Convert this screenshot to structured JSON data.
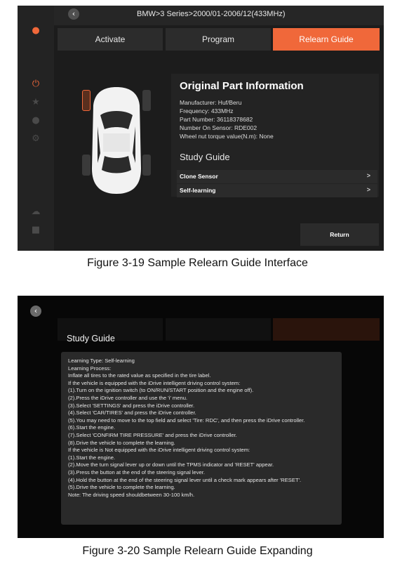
{
  "figure1": {
    "breadcrumb": "BMW>3 Series>2000/01-2006/12(433MHz)",
    "tabs": [
      "Activate",
      "Program",
      "Relearn Guide"
    ],
    "active_tab": "Relearn Guide",
    "sidebar_icons": [
      "user-icon",
      "tpms-icon",
      "star-icon",
      "lightbulb-icon",
      "gear-icon",
      "cloud-upload-icon",
      "book-icon"
    ],
    "info": {
      "title": "Original Part Information",
      "manufacturer": "Manufacturer: Huf/Beru",
      "frequency": "Frequency: 433MHz",
      "part_number": "Part Number: 36118378682",
      "sensor_number": "Number On Sensor: RDE002",
      "torque": "Wheel nut torque value(N.m): None"
    },
    "study_guide_title": "Study Guide",
    "guide_options": [
      {
        "label": "Clone Sensor",
        "chevron": ">"
      },
      {
        "label": "Self-learning",
        "chevron": ">"
      }
    ],
    "return_label": "Return",
    "caption": "Figure 3-19 Sample Relearn Guide Interface"
  },
  "figure2": {
    "heading": "Study Guide",
    "lines": [
      "Learning Type: Self-learning",
      "Learning Process:",
      "Inflate all tires to the rated value as specified in the tire label.",
      "If the vehicle is equipped with the iDrive intelligent driving control system:",
      "(1).Turn on the ignition switch (to ON/RUN/START position and the engine off).",
      "(2).Press the iDrive controller and use the 'i' menu.",
      "(3).Select 'SETTINGS' and press the iDrive controller.",
      "(4).Select 'CAR/TIRES' and press the iDrive controller.",
      "(5).You may need to move to the top field and select 'Tire: RDC', and then press the iDrive controller.",
      "(6).Start the engine.",
      "(7).Select 'CONFIRM TIRE PRESSURE' and press the iDrive controller.",
      "(8).Drive the vehicle to complete the learning.",
      "If the vehicle is Not equipped with the iDrive intelligent driving control system:",
      "(1).Start the engine.",
      "(2).Move the turn signal lever up or down until the TPMS indicator and 'RESET' appear.",
      "(3).Press the button at the end of the steering signal lever.",
      "(4).Hold the button at the end of the steering signal lever until a check mark appears after 'RESET'.",
      "(5).Drive the vehicle to complete the learning.",
      "Note: The driving speed shouldbetween 30-100 km/h."
    ],
    "caption": "Figure 3-20 Sample Relearn Guide Expanding"
  },
  "colors": {
    "accent": "#f0683a",
    "background": "#1c1c1c",
    "panel": "#232323",
    "overlay_box": "#2a2a2a"
  }
}
